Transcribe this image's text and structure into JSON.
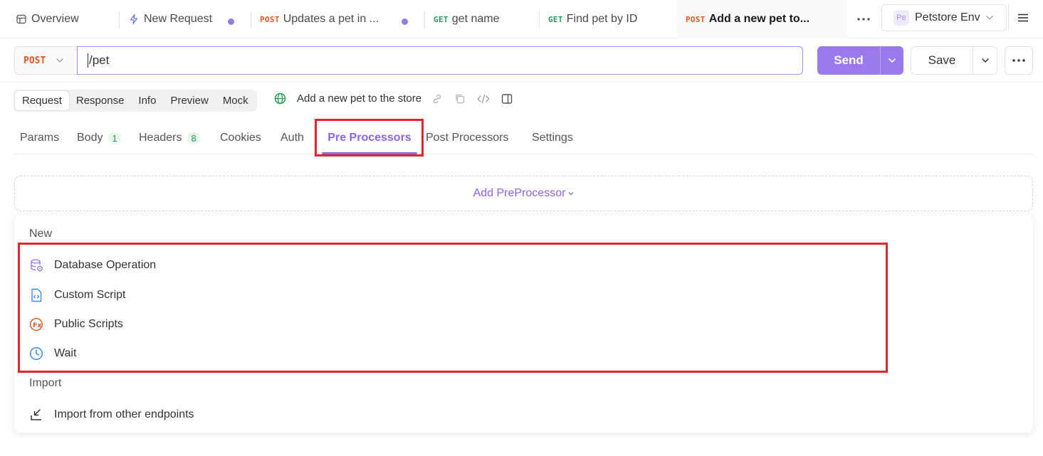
{
  "tabs": [
    {
      "label": "Overview",
      "icon": "overview-icon"
    },
    {
      "label": "New Request",
      "icon": "lightning-icon",
      "unsaved": true
    },
    {
      "method": "POST",
      "label": "Updates a pet in ...",
      "unsaved": true
    },
    {
      "method": "GET",
      "label": "get name"
    },
    {
      "method": "GET",
      "label": "Find pet by ID"
    },
    {
      "method": "POST",
      "label": "Add a new pet to...",
      "active": true
    }
  ],
  "environment": {
    "badge": "Pe",
    "label": "Petstore Env"
  },
  "request": {
    "method": "POST",
    "url": "/pet",
    "send_label": "Send",
    "save_label": "Save",
    "title": "Add a new pet to the store"
  },
  "view_modes": [
    "Request",
    "Response",
    "Info",
    "Preview",
    "Mock"
  ],
  "active_view_mode": "Request",
  "subtabs": {
    "params": "Params",
    "body": "Body",
    "body_count": "1",
    "headers": "Headers",
    "headers_count": "8",
    "cookies": "Cookies",
    "auth": "Auth",
    "pre": "Pre Processors",
    "post": "Post Processors",
    "settings": "Settings"
  },
  "active_subtab": "Pre Processors",
  "add_preprocessor_label": "Add PreProcessor",
  "menu": {
    "new_group": "New",
    "items": [
      {
        "label": "Database Operation",
        "icon": "database-icon"
      },
      {
        "label": "Custom Script",
        "icon": "script-file-icon"
      },
      {
        "label": "Public Scripts",
        "icon": "function-icon"
      },
      {
        "label": "Wait",
        "icon": "clock-icon"
      }
    ],
    "import_group": "Import",
    "import_item": {
      "label": "Import from other endpoints",
      "icon": "import-icon"
    }
  },
  "colors": {
    "accent": "#8a63e6",
    "post": "#e8541f",
    "get": "#22a05a",
    "highlight": "#e0262a"
  }
}
